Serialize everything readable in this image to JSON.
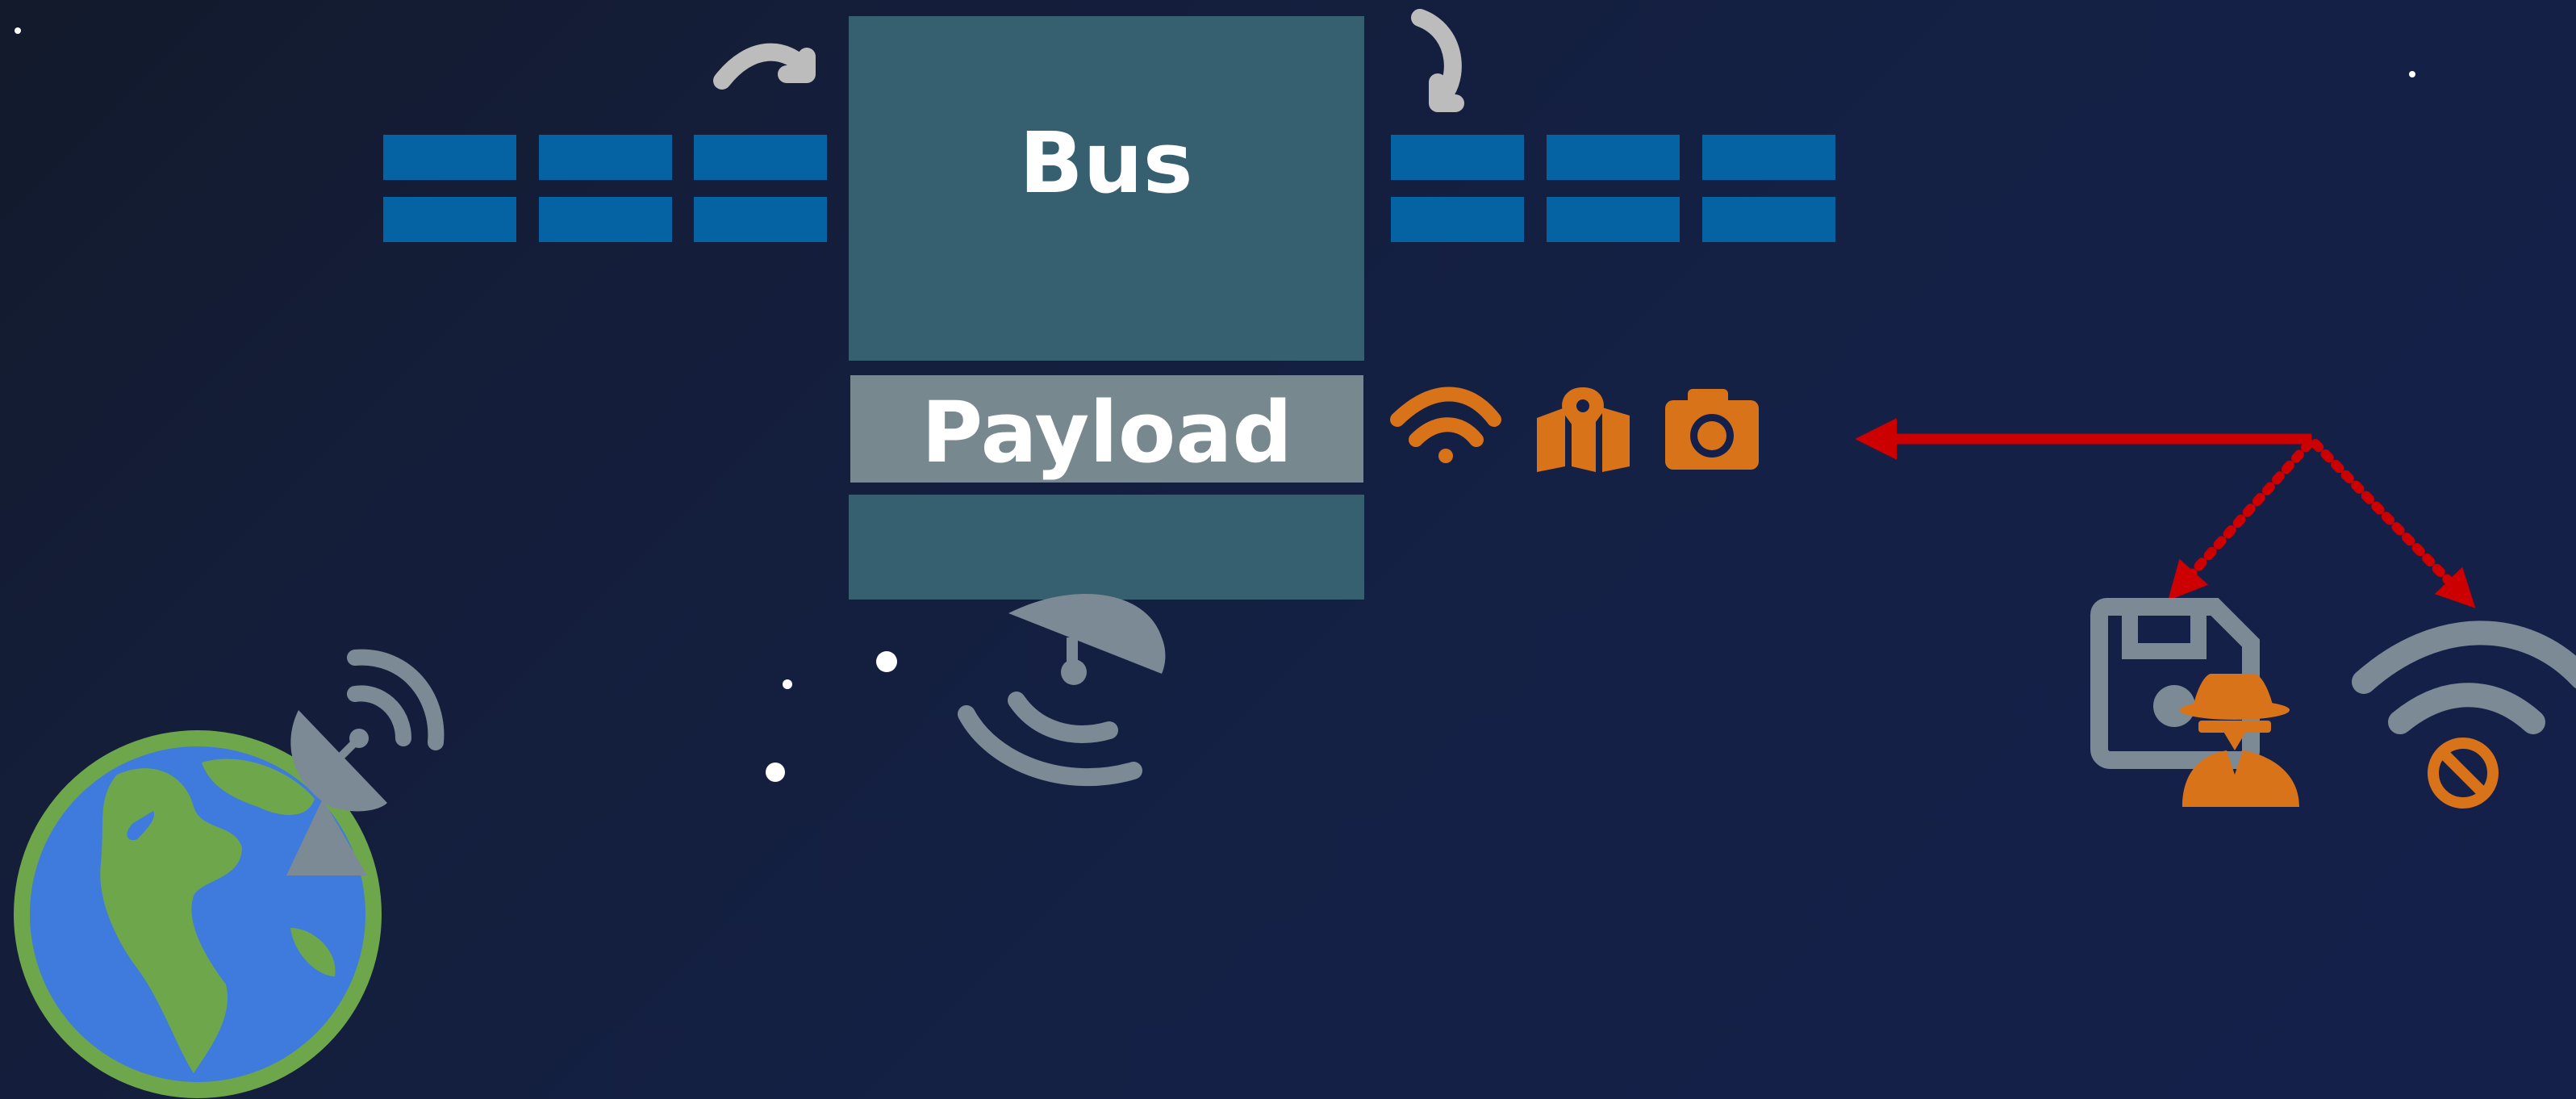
{
  "satellite": {
    "bus_label": "Bus",
    "payload_label": "Payload"
  },
  "colors": {
    "background": "#14204a",
    "bus": "#365f70",
    "payload": "#77898f",
    "solar_panel": "#0563a3",
    "icon_gray": "#7b8a94",
    "rotation_arrow": "#bcbcbc",
    "payload_icons": "#d9731a",
    "attack_arrow": "#cc0000",
    "earth_ocean": "#3f7bdc",
    "earth_land": "#6ea74b",
    "stars": "#ffffff"
  },
  "icons": {
    "payload_functions": [
      "wifi-icon",
      "map-location-icon",
      "camera-icon"
    ],
    "ground": [
      "earth-icon",
      "satellite-dish-icon"
    ],
    "satellite_antenna": "satellite-dish-icon",
    "threats": [
      "floppy-disk-icon",
      "spy-icon",
      "wifi-icon",
      "ban-icon"
    ],
    "rotation": [
      "clockwise-arrow-icon",
      "clockwise-arrow-icon"
    ]
  }
}
